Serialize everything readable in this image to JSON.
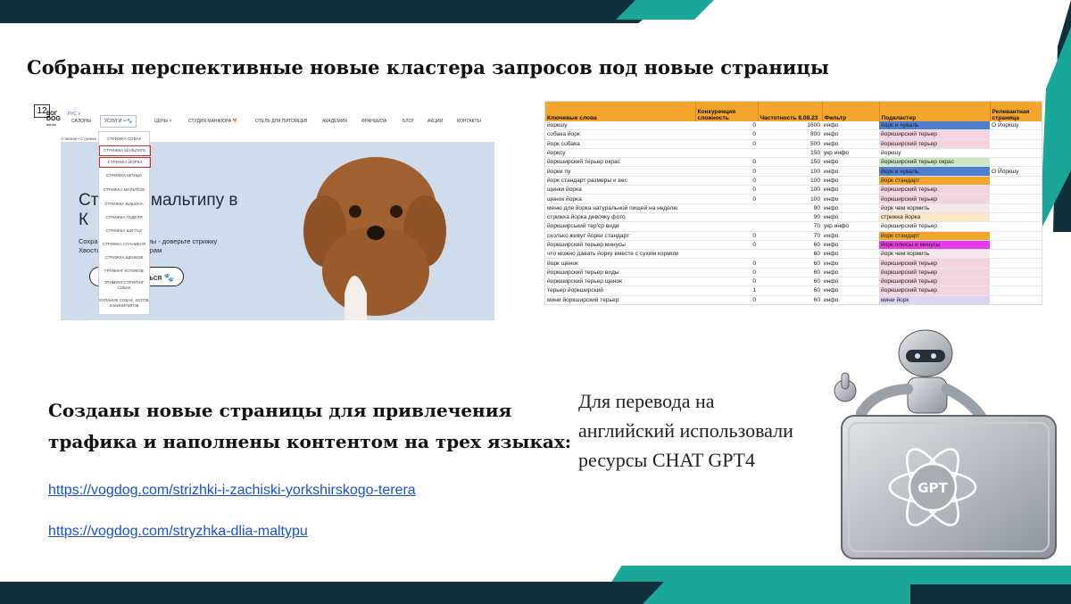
{
  "slide": {
    "page_number": "12",
    "title": "Собраны перспективные новые кластера запросов под новые страницы",
    "subtitle_line1": "Созданы новые страницы для привлечения",
    "subtitle_line2": "трафика и наполнены контентом на трех языках:",
    "link1": "https://vogdog.com/strizhki-i-zachiski-yorkshirskogo-terera",
    "link2": "https://vogdog.com/stryzhka-dlia-maltypu",
    "note_line1": "Для перевода на",
    "note_line2": "английский использовали",
    "note_line3": "ресурсы CHAT GPT4",
    "gpt_logo": "GPT",
    "colors": {
      "teal": "#1aa79a",
      "dark": "#0f2f3a",
      "header_orange": "#f4a52c"
    }
  },
  "site": {
    "logo_top": "ВОГ",
    "logo": "DOG",
    "logo_sub": "SALON",
    "lang": "РУС ˅",
    "nav": [
      "САЛОНЫ",
      "УСЛУГИ ✂🐾",
      "ЦЕНЫ ˅",
      "СТУДИЯ МАНІКЮРА 🐕",
      "ОТЕЛЬ ДЛЯ ПИТОМЦЕВ",
      "АКАДЕМИЯ",
      "ФРАНШИЗА",
      "БЛОГ",
      "АКЦИИ",
      "КОНТАКТЫ"
    ],
    "breadcrumb": "Главная • Стрижки",
    "hero_title_1": "Стрижка мальтипу в",
    "hero_title_2": "К",
    "hero_text_1": "Сохраните время и силы - доверьте стрижку",
    "hero_text_2": "Хвостика нашим грумерам",
    "hero_button": "Записаться",
    "paw_icon": "🐾",
    "dropdown": [
      "СТРИЖКА СОБАК",
      "СТРИЖКА МАЛЬТИПУ",
      "СТРИЖКА ЙОРКА",
      "СТРИЖКА ШПИЦА",
      "СТРИЖКА МАЛЬТЕЗЕ",
      "СТРИЖКА БИШОНА",
      "СТРИЖКА ПУДЕЛЯ",
      "СТРИЖКА ШИ-ТЦУ",
      "СТРИЖКА СПАНИЕЛЯ",
      "СТРИЖКА ЩЕНКОВ",
      "ГРУМИНГ КОТИКОВ",
      "ТРИМИНГ,СТРИПІНГ СОБАК",
      "КУПАНИЕ СОБАК, КОТОВ И МИНИПИГОВ"
    ]
  },
  "sheet": {
    "headers": [
      "Ключевые слова",
      "Конкуренция сложность",
      "Частотность 8.08.23",
      "Фильтр",
      "Подкластер",
      "Релевантная страница"
    ],
    "rows": [
      [
        "йоркшу",
        "0",
        "1600",
        "инфо",
        "йорк и чуваль",
        "О Йоркшу",
        "#4f7fd1"
      ],
      [
        "собака йорк",
        "0",
        "800",
        "инфо",
        "йоркширский терьер",
        "",
        "#f3d3df"
      ],
      [
        "йорк собака",
        "0",
        "500",
        "инфо",
        "йоркширский терьер",
        "",
        "#f3d3df"
      ],
      [
        "йорксу",
        "",
        "150",
        "укр инфо",
        "йоркшу",
        "",
        "#ffffff"
      ],
      [
        "йоркширский терьер окрас",
        "0",
        "150",
        "инфо",
        "йоркширский терьер окрас",
        "",
        "#cde7c4"
      ],
      [
        "йорки пу",
        "0",
        "100",
        "инфо",
        "йорк и чуваль",
        "О Йоркшу",
        "#4f7fd1"
      ],
      [
        "йорк стандарт размеры и вес",
        "0",
        "100",
        "инфо",
        "йорк стандарт",
        "",
        "#f4a52c"
      ],
      [
        "щенки йорка",
        "0",
        "100",
        "инфо",
        "йоркширский терьер",
        "",
        "#f3d3df"
      ],
      [
        "щенок йорка",
        "0",
        "100",
        "инфо",
        "йоркширский терьер",
        "",
        "#f3d3df"
      ],
      [
        "меню для йорка натуральной пищей на неделю",
        "",
        "90",
        "инфо",
        "йорк чем кормить",
        "",
        "#f7e7ea"
      ],
      [
        "стрижка йорка девочку фото",
        "",
        "90",
        "инфо",
        "стрижка йорка",
        "",
        "#fbe6c6"
      ],
      [
        "йоркширський тер'єр види",
        "",
        "70",
        "укр инфо",
        "йоркширский терьер",
        "",
        "#ffffff"
      ],
      [
        "сколько живут йорки стандарт",
        "0",
        "70",
        "инфо",
        "йорк стандарт",
        "",
        "#f4a52c"
      ],
      [
        "йоркширский терьер минусы",
        "0",
        "60",
        "инфо",
        "йорк плюсы и минусы",
        "",
        "#e63be6"
      ],
      [
        "что можно давать йорку вместе с сухим кормом",
        "",
        "60",
        "инфо",
        "йорк чем кормить",
        "",
        "#f7e7ea"
      ],
      [
        "йорк щенок",
        "0",
        "60",
        "инфо",
        "йоркширский терьер",
        "",
        "#f3d3df"
      ],
      [
        "йоркширский терьер виды",
        "0",
        "60",
        "инфо",
        "йоркширский терьер",
        "",
        "#f3d3df"
      ],
      [
        "йоркширский терьер щенок",
        "0",
        "60",
        "инфо",
        "йоркширский терьер",
        "",
        "#f3d3df"
      ],
      [
        "терьер йоркширский",
        "1",
        "60",
        "инфо",
        "йоркширский терьер",
        "",
        "#f3d3df"
      ],
      [
        "мини йоркширский терьер",
        "0",
        "60",
        "инфо",
        "мини йорк",
        "",
        "#dcd4f0"
      ],
      [
        "сколько живут йоркширские терьеры",
        "0",
        "60",
        "инфо",
        "сколько живут",
        "",
        "#c9dcf3"
      ]
    ]
  }
}
